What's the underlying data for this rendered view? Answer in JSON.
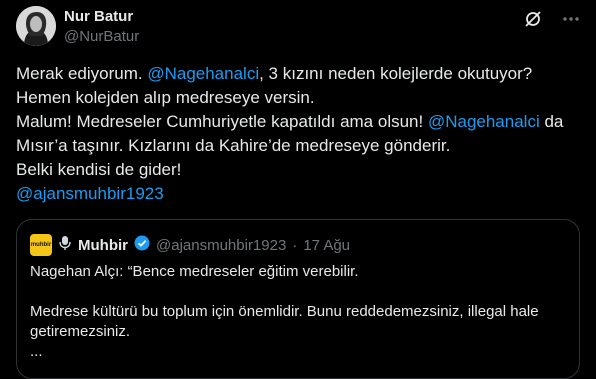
{
  "author": {
    "name": "Nur Batur",
    "handle": "@NurBatur"
  },
  "tweet": {
    "line1_pre": "Merak ediyorum. ",
    "line1_mention": "@Nagehanalci",
    "line1_post": ", 3 kızını neden kolejlerde okutuyor?",
    "line2": "Hemen kolejden alıp medreseye versin.",
    "line3_pre": "Malum! Medreseler Cumhuriyetle kapatıldı ama olsun! ",
    "line3_mention": "@Nagehanalci",
    "line3_post": " da",
    "line4": "Mısır’a taşınır. Kızlarını da Kahire’de medreseye gönderir.",
    "line5": "Belki kendisi de gider!",
    "line6_mention": "@ajansmuhbir1923"
  },
  "quoted": {
    "logo_text": "muhbir",
    "name": "Muhbir",
    "handle": "@ajansmuhbir1923",
    "separator": "·",
    "date": "17 Ağu",
    "line1": "Nagehan Alçı: “Bence medreseler eğitim verebilir.",
    "line2": "Medrese kültürü bu toplum için önemlidir. Bunu reddedemezsiniz, illegal hale getiremezsiniz.",
    "line3": "..."
  },
  "icons": {
    "grok": "grok-icon",
    "more": "more-icon",
    "microphone": "microphone-icon",
    "verified": "verified-badge-icon"
  },
  "colors": {
    "background": "#000000",
    "text": "#e7e9ea",
    "secondary": "#71767b",
    "link": "#1d9bf0",
    "border": "#2f3336"
  }
}
